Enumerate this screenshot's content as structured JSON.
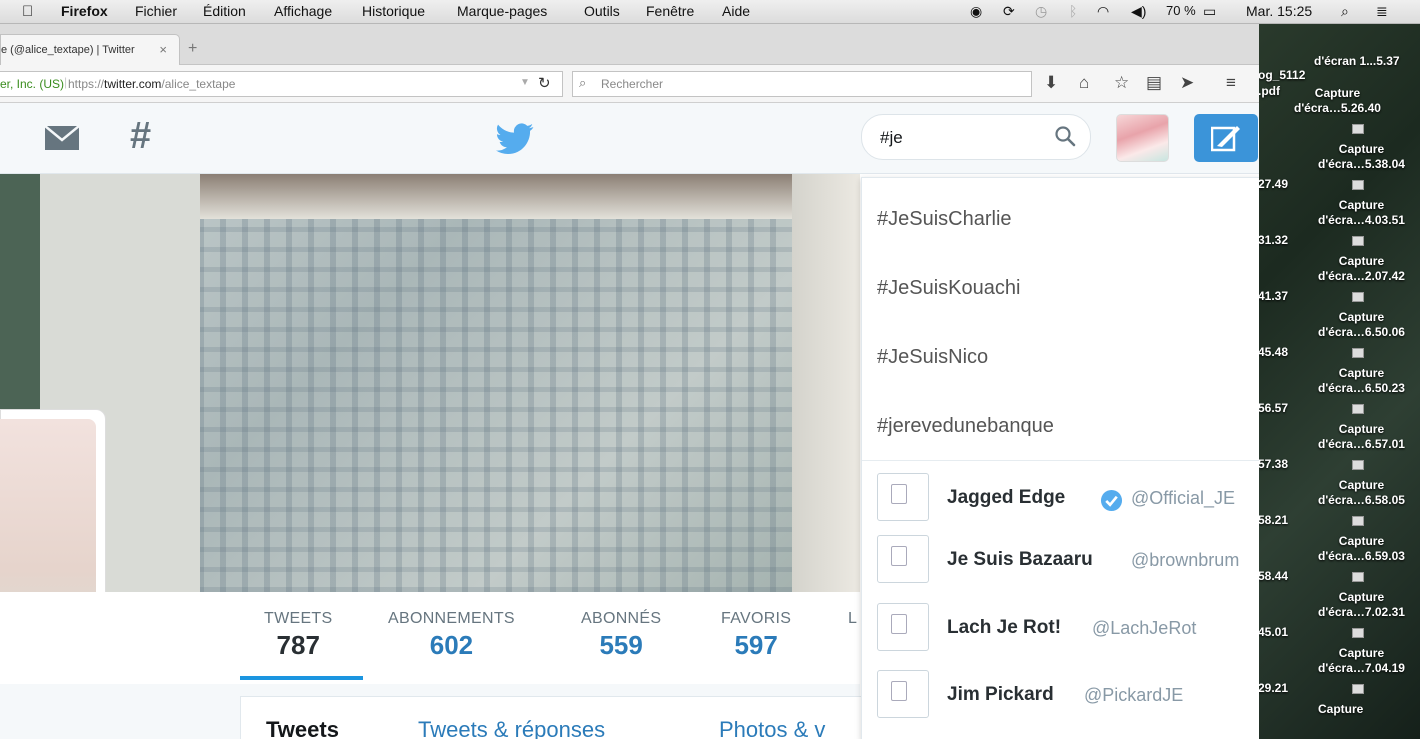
{
  "menubar": {
    "apple": "",
    "items": [
      "Firefox",
      "Fichier",
      "Édition",
      "Affichage",
      "Historique",
      "Marque-pages",
      "Outils",
      "Fenêtre",
      "Aide"
    ],
    "battery": "70 %",
    "clock": "Mar. 15:25"
  },
  "browser": {
    "tab_title": "e (@alice_textape) | Twitter",
    "identity": "er, Inc. (US)",
    "url_prefix": "https://",
    "url_host": "twitter.com",
    "url_path": "/alice_textape",
    "search_placeholder": "Rechercher"
  },
  "twitter": {
    "search_value": "#je",
    "suggestions": [
      "#JeSuisCharlie",
      "#JeSuisKouachi",
      "#JeSuisNico",
      "#jerevedunebanque"
    ],
    "users": [
      {
        "name": "Jagged Edge",
        "handle": "@Official_JE",
        "verified": true
      },
      {
        "name": "Je Suis Bazaaru",
        "handle": "@brownbrum",
        "verified": false
      },
      {
        "name": "Lach Je Rot!",
        "handle": "@LachJeRot",
        "verified": false
      },
      {
        "name": "Jim Pickard",
        "handle": "@PickardJE",
        "verified": false
      }
    ],
    "stats": [
      {
        "label": "TWEETS",
        "value": "787"
      },
      {
        "label": "ABONNEMENTS",
        "value": "602"
      },
      {
        "label": "ABONNÉS",
        "value": "559"
      },
      {
        "label": "FAVORIS",
        "value": "597"
      },
      {
        "label": "L",
        "value": ""
      }
    ],
    "timeline_tabs": [
      "Tweets",
      "Tweets & réponses",
      "Photos & v"
    ],
    "colors": {
      "brand": "#1da1f2",
      "link": "#2b7bb9"
    }
  },
  "desktop": {
    "files": [
      {
        "a": "Capture",
        "b": "d'écra…5.26.40"
      },
      {
        "a": "Capture",
        "b": "d'écra…5.38.04"
      },
      {
        "a": "Capture",
        "b": "d'écra…4.03.51"
      },
      {
        "a": "Capture",
        "b": "d'écra…2.07.42"
      },
      {
        "a": "Capture",
        "b": "d'écra…6.50.06"
      },
      {
        "a": "Capture",
        "b": "d'écra…6.50.23"
      },
      {
        "a": "Capture",
        "b": "d'écra…6.57.01"
      },
      {
        "a": "Capture",
        "b": "d'écra…6.58.05"
      },
      {
        "a": "Capture",
        "b": "d'écra…6.59.03"
      },
      {
        "a": "Capture",
        "b": "d'écra…7.02.31"
      },
      {
        "a": "Capture",
        "b": "d'écra…7.04.19"
      },
      {
        "a": "Capture",
        "b": ""
      }
    ],
    "left_col": [
      "og_5112",
      ".pdf",
      "27.49",
      "31.32",
      "41.37",
      "45.48",
      "56.57",
      "57.38",
      "58.21",
      "58.44",
      "45.01",
      "29.21"
    ],
    "top_label": "d'écran 1...5.37"
  }
}
